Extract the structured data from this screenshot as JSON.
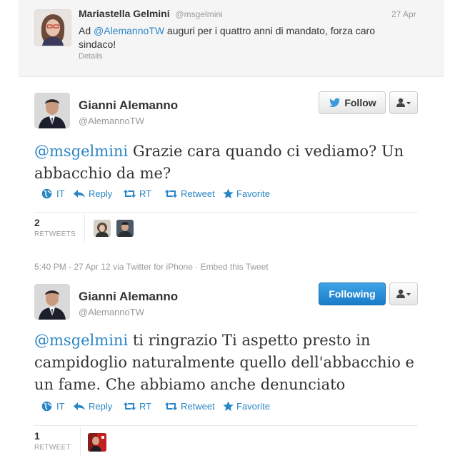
{
  "reply_tweet": {
    "name": "Mariastella Gelmini",
    "handle": "@msgelmini",
    "date": "27 Apr",
    "mention": "@AlemannoTW",
    "text_line1": " auguri per i quattro anni di mandato, forza caro",
    "text_line2": "sindaco!",
    "details_label": "Details"
  },
  "tweet1": {
    "name": "Gianni Alemanno",
    "handle": "@AlemannoTW",
    "follow_label": "Follow",
    "mention": "@msgelmini",
    "text_line1": " Grazie cara quando ci vediamo? Un",
    "text_line2": "abbacchio da me?",
    "actions": {
      "lang": "IT",
      "reply": "Reply",
      "rt": "RT",
      "retweet": "Retweet",
      "favorite": "Favorite"
    },
    "retweet_count": "2",
    "retweet_caption": "RETWEETS",
    "meta": "5:40 PM - 27 Apr 12 via Twitter for iPhone · Embed this Tweet"
  },
  "tweet2": {
    "name": "Gianni Alemanno",
    "handle": "@AlemannoTW",
    "follow_label": "Following",
    "mention": "@msgelmini",
    "text_line1": " ti ringrazio Ti aspetto presto in",
    "text_line2": "campidoglio naturalmente quello dell'abbacchio e",
    "text_line3": "un fame. Che abbiamo anche denunciato",
    "actions": {
      "lang": "IT",
      "reply": "Reply",
      "rt": "RT",
      "retweet": "Retweet",
      "favorite": "Favorite"
    },
    "retweet_count": "1",
    "retweet_caption": "RETWEET"
  },
  "colors": {
    "link": "#2a85c5",
    "following_button": "#2a8ad8",
    "background": "#ffffff",
    "reply_background": "#f5f5f5"
  }
}
